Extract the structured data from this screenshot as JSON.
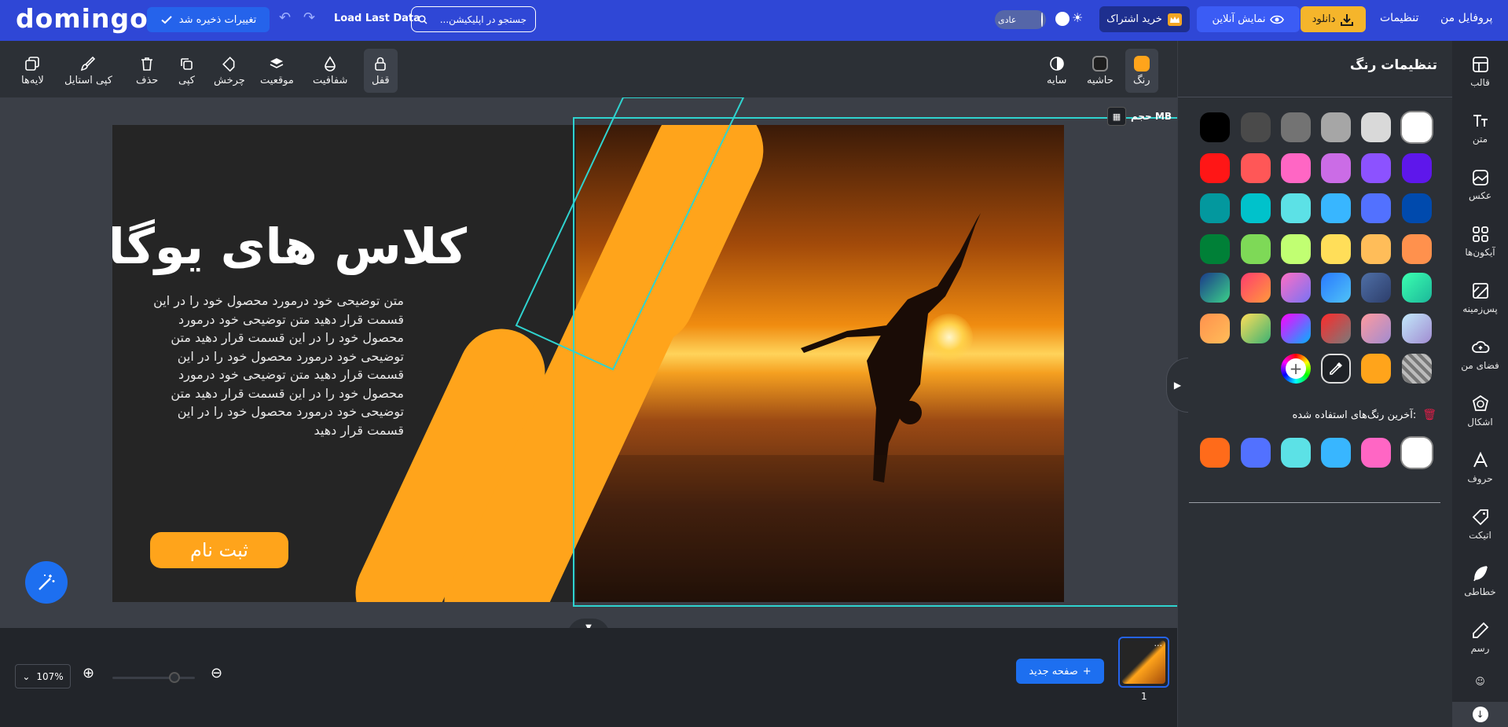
{
  "app": {
    "logo": "domingo"
  },
  "topbar": {
    "save_label": "تغییرات ذخیره شد",
    "load_last": "Load Last Data",
    "search_placeholder": "جستجو در اپلیکیشن...",
    "mode_label": "عادی",
    "subscribe_label": "خرید اشتراک",
    "online_label": "نمایش آنلاین",
    "download_label": "دانلود",
    "settings_label": "تنظیمات",
    "profile_label": "پروفایل من"
  },
  "toolbar": {
    "color": "رنگ",
    "border": "حاشیه",
    "shadow": "سایه",
    "lock": "قفل",
    "opacity": "شفافیت",
    "position": "موقعیت",
    "rotate": "چرخش",
    "copy": "کپی",
    "delete": "حذف",
    "copy_style": "کپی استایل",
    "layers": "لایه‌ها"
  },
  "canvas": {
    "size_label": "حجم MB",
    "title": "کلاس های یوگا",
    "description": "متن توضیحی خود درمورد محصول خود را در این قسمت قرار دهید متن توضیحی خود درمورد محصول خود را در این قسمت قرار دهید متن توضیحی خود درمورد محصول خود را در این قسمت قرار دهید متن توضیحی خود درمورد محصول خود را در این قسمت قرار دهید متن توضیحی خود درمورد محصول خود را در این قسمت قرار دهید",
    "signup": "ثبت نام",
    "accent_color": "#ffa41b",
    "selection_color": "#2fd3cf"
  },
  "color_panel": {
    "title": "تنظیمات رنگ",
    "recent_label": "آخرین رنگ‌های استفاده شده:",
    "palette": [
      "#000000",
      "#4a4a4a",
      "#737373",
      "#a6a6a6",
      "#d9d9d9",
      "#ffffff",
      "#ff1616",
      "#ff5757",
      "#ff66c4",
      "#cb6ce6",
      "#8c52ff",
      "#5e17eb",
      "#03989e",
      "#00c2cb",
      "#5ce1e6",
      "#38b6ff",
      "#5271ff",
      "#004aad",
      "#008037",
      "#7ed957",
      "#c1ff72",
      "#ffde59",
      "#ffbd59",
      "#ff914d"
    ],
    "gradients": [
      [
        "#3bffb0",
        "#1cb89a"
      ],
      [
        "#4f6fa6",
        "#2d3e6b"
      ],
      [
        "#2979ff",
        "#4fc3f7"
      ],
      [
        "#ff6ec4",
        "#7873f5"
      ],
      [
        "#ff3c6e",
        "#ff9a3c"
      ],
      [
        "#1b3a8a",
        "#3bd18a"
      ],
      [
        "#c2e9fb",
        "#a18cd1"
      ],
      [
        "#ff9a9e",
        "#a18cd1"
      ],
      [
        "#ff2a2a",
        "#7a7a7a"
      ],
      [
        "#ff00ff",
        "#00b3ff"
      ],
      [
        "#ffde59",
        "#3bb273"
      ],
      [
        "#ff914d",
        "#ffbd59"
      ]
    ],
    "recent": [
      "#ffffff",
      "#ff66c4",
      "#38b6ff",
      "#5ce1e6",
      "#5271ff",
      "#ff6b1a"
    ]
  },
  "sidebar": {
    "items": [
      {
        "label": "قالب",
        "icon": "template-icon"
      },
      {
        "label": "متن",
        "icon": "text-icon"
      },
      {
        "label": "عکس",
        "icon": "photo-icon"
      },
      {
        "label": "آیکون‌ها",
        "icon": "grid-icon"
      },
      {
        "label": "پس‌زمینه",
        "icon": "background-icon"
      },
      {
        "label": "فضای من",
        "icon": "cloud-icon"
      },
      {
        "label": "اشکال",
        "icon": "shapes-icon"
      },
      {
        "label": "حروف",
        "icon": "letters-icon"
      },
      {
        "label": "اتیکت",
        "icon": "tag-icon"
      },
      {
        "label": "خطاطی",
        "icon": "feather-icon"
      },
      {
        "label": "رسم",
        "icon": "pen-icon"
      }
    ]
  },
  "bottombar": {
    "zoom": "107%",
    "zoom_fraction": 0.75,
    "new_page": "صفحه جدید",
    "page_number": "1"
  }
}
